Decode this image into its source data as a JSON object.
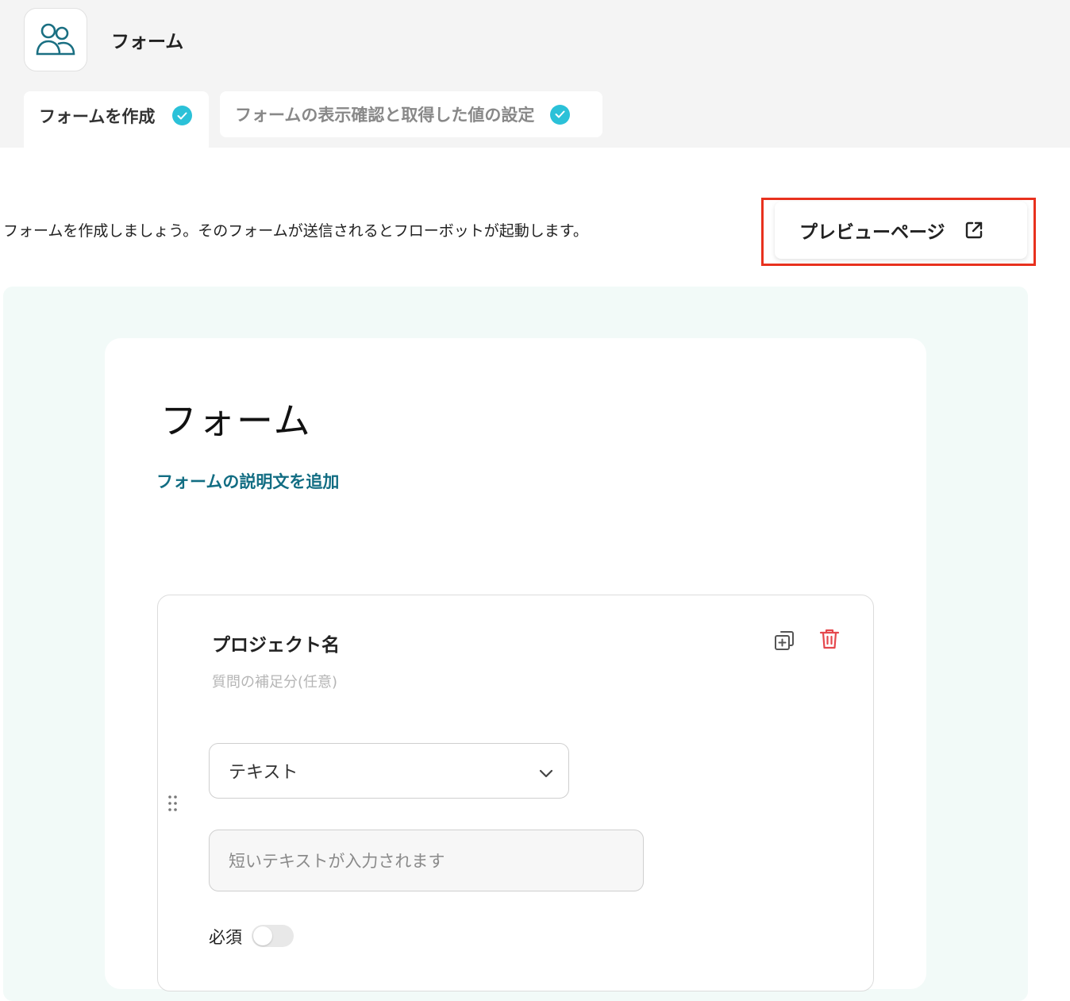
{
  "header": {
    "app_icon": "users-icon",
    "title": "フォーム",
    "tabs": [
      {
        "label": "フォームを作成",
        "status_icon": "check-circle-icon"
      },
      {
        "label": "フォームの表示確認と取得した値の設定",
        "status_icon": "check-circle-icon"
      }
    ]
  },
  "toolbar": {
    "description": "フォームを作成しましょう。そのフォームが送信されるとフローボットが起動します。",
    "preview_label": "プレビューページ",
    "preview_icon": "external-link-icon"
  },
  "form": {
    "title": "フォーム",
    "add_description_label": "フォームの説明文を追加",
    "question": {
      "title": "プロジェクト名",
      "help_placeholder": "質問の補足分(任意)",
      "type_selected": "テキスト",
      "input_placeholder": "短いテキストが入力されます",
      "required_label": "必須",
      "required": false
    }
  },
  "colors": {
    "accent": "#2bc1d8",
    "link": "#126d83",
    "highlight_border": "#e8311e",
    "delete": "#e5484d",
    "canvas_bg": "#f2faf8"
  }
}
